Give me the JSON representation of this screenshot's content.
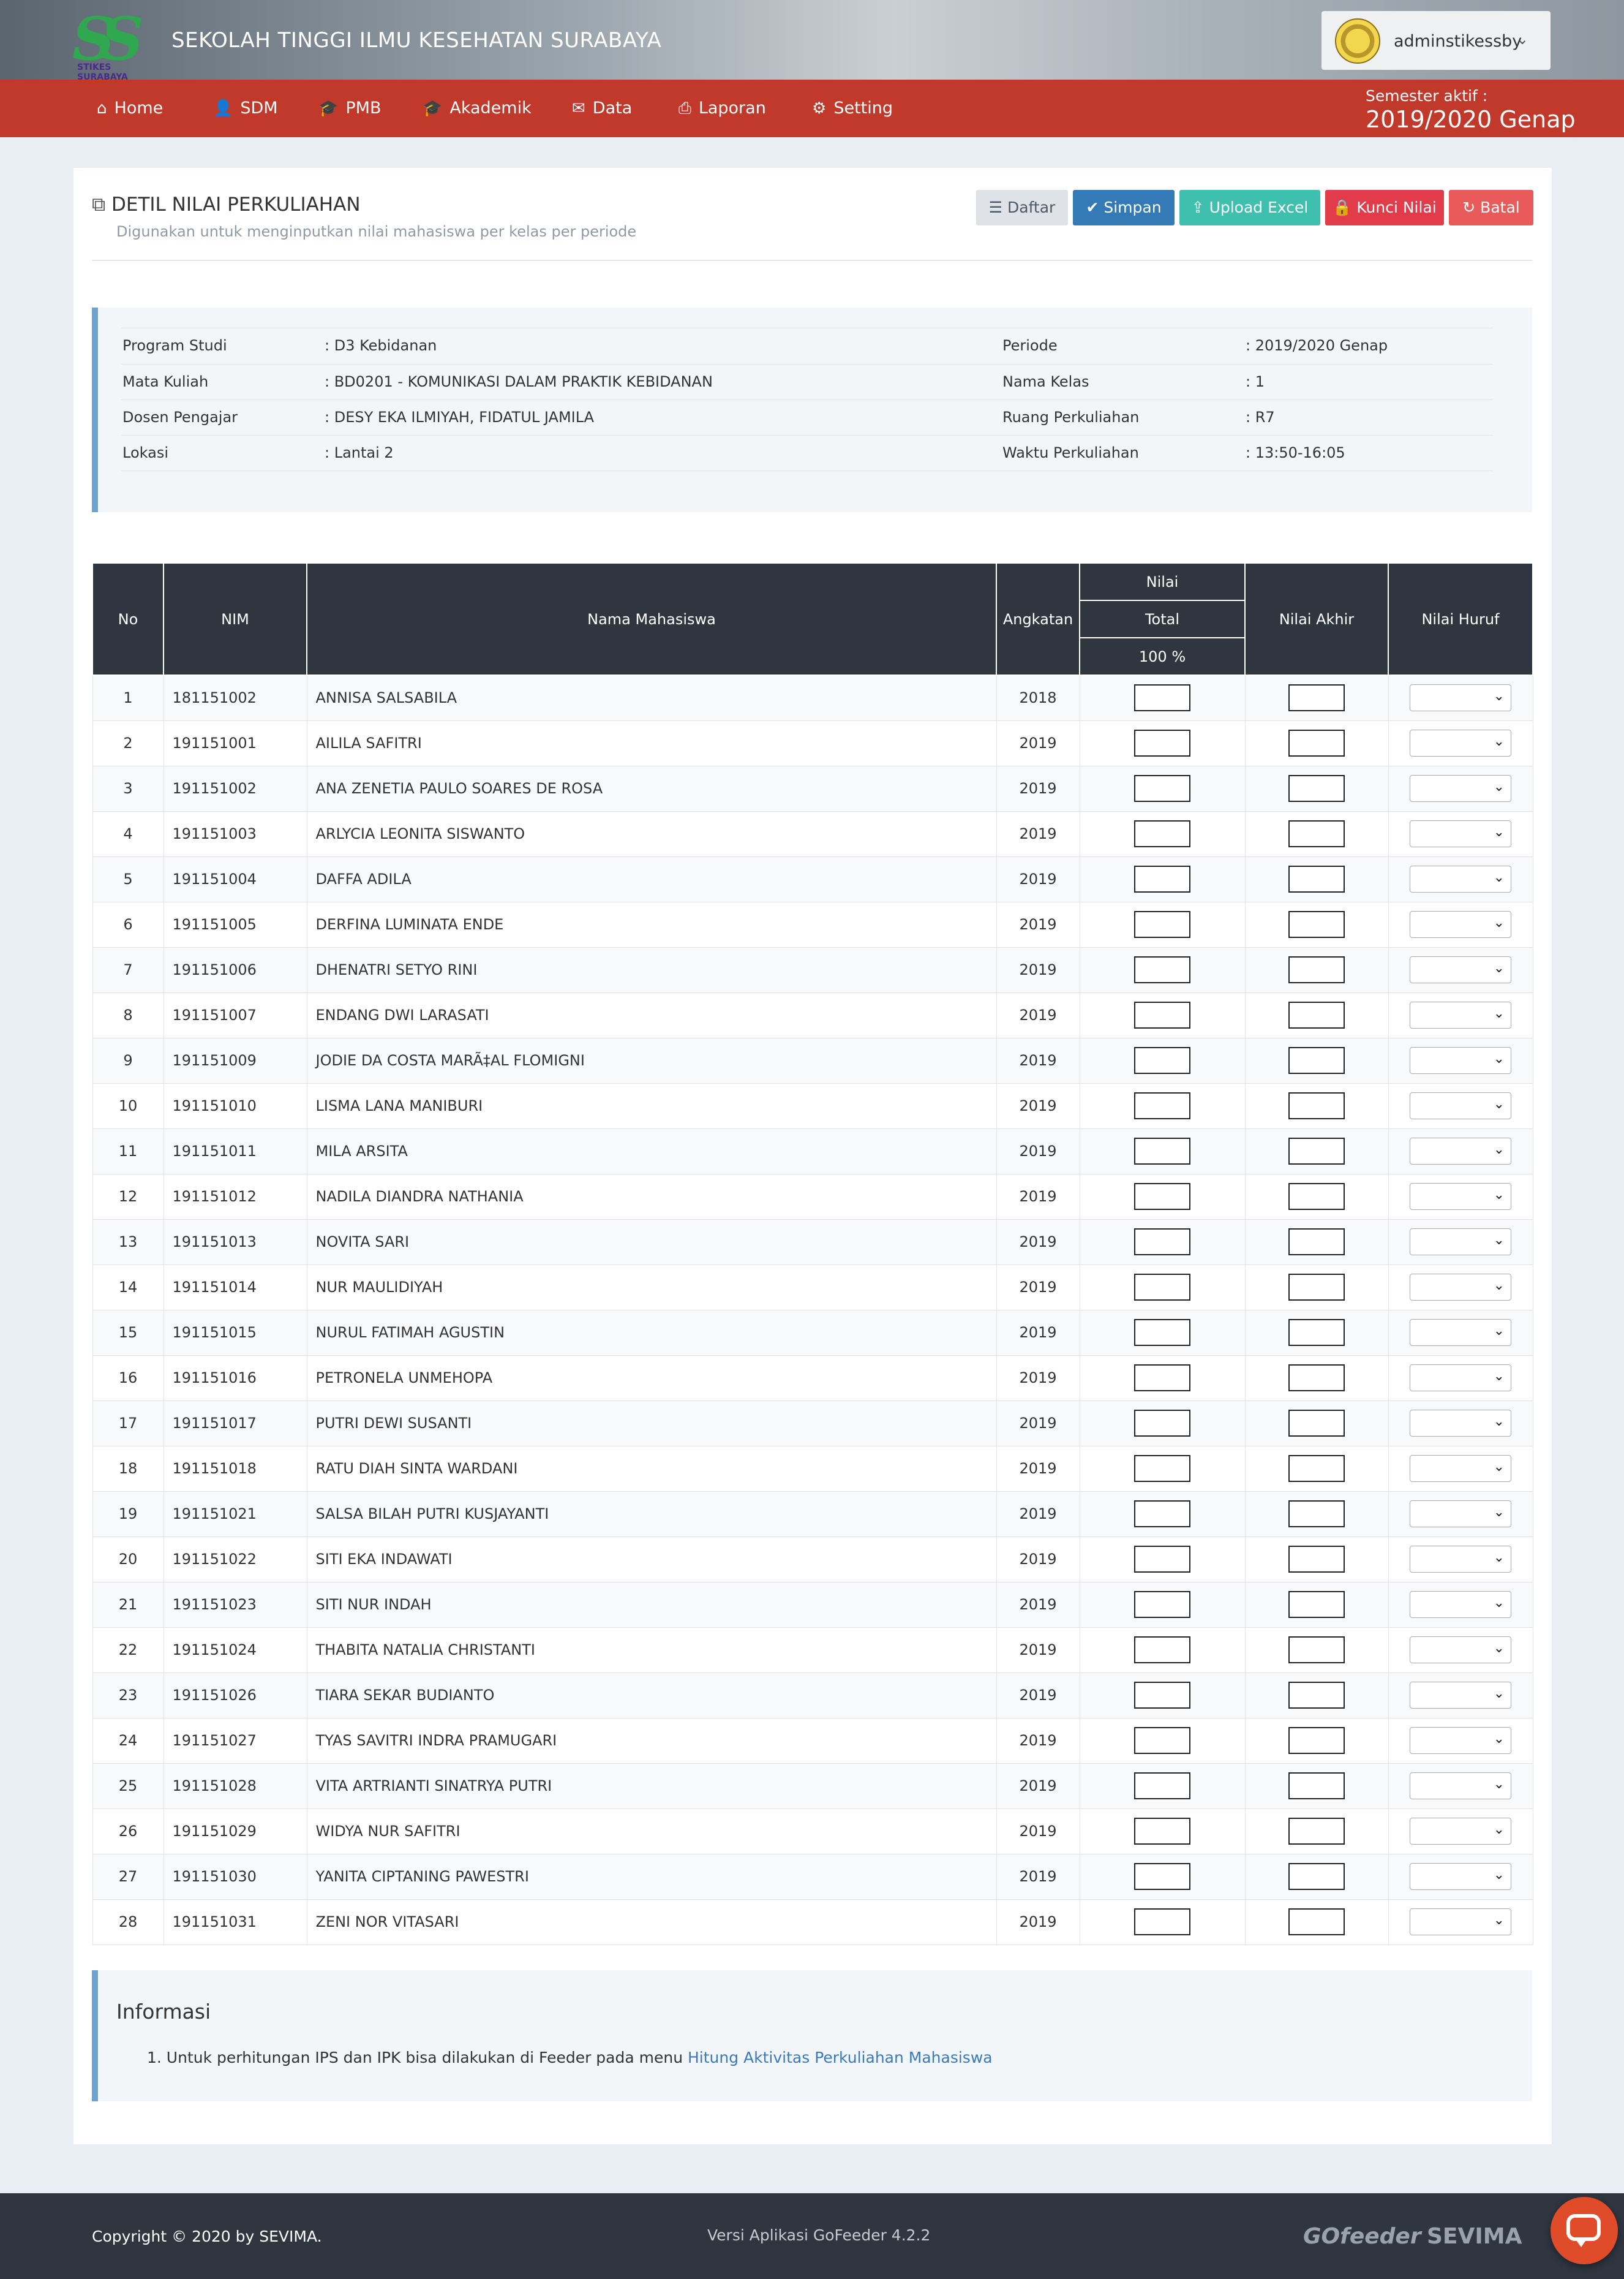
{
  "header": {
    "title": "SEKOLAH TINGGI ILMU KESEHATAN SURABAYA",
    "logo_text": "STIKES SURABAYA",
    "username": "adminstikessby"
  },
  "nav": [
    {
      "label": "Home",
      "icon": "home-icon"
    },
    {
      "label": "SDM",
      "icon": "user-icon"
    },
    {
      "label": "PMB",
      "icon": "graduation-cap-icon"
    },
    {
      "label": "Akademik",
      "icon": "graduation-cap-icon"
    },
    {
      "label": "Data",
      "icon": "inbox-icon"
    },
    {
      "label": "Laporan",
      "icon": "printer-icon"
    },
    {
      "label": "Setting",
      "icon": "gear-icon"
    }
  ],
  "semester": {
    "label": "Semester aktif :",
    "value": "2019/2020 Genap"
  },
  "page": {
    "title": "DETIL NILAI PERKULIAHAN",
    "subtitle": "Digunakan untuk menginputkan nilai mahasiswa per kelas per periode"
  },
  "buttons": {
    "daftar": "Daftar",
    "simpan": "Simpan",
    "upload": "Upload Excel",
    "kunci": "Kunci Nilai",
    "batal": "Batal"
  },
  "colors": {
    "red": "#c0392b",
    "blue": "#337ab7",
    "teal": "#3fbfad",
    "danger": "#e23b4a",
    "dark": "#2f3640"
  },
  "info": {
    "left": [
      {
        "label": "Program Studi",
        "value": ": D3 Kebidanan"
      },
      {
        "label": "Mata Kuliah",
        "value": ": BD0201 - KOMUNIKASI DALAM PRAKTIK KEBIDANAN"
      },
      {
        "label": "Dosen Pengajar",
        "value": ": DESY EKA ILMIYAH, FIDATUL JAMILA"
      },
      {
        "label": "Lokasi",
        "value": ": Lantai 2"
      }
    ],
    "right": [
      {
        "label": "Periode",
        "value": ": 2019/2020 Genap"
      },
      {
        "label": "Nama Kelas",
        "value": ": 1"
      },
      {
        "label": "Ruang Perkuliahan",
        "value": ": R7"
      },
      {
        "label": "Waktu Perkuliahan",
        "value": ": 13:50-16:05"
      }
    ]
  },
  "table": {
    "headers": {
      "no": "No",
      "nim": "NIM",
      "nama": "Nama Mahasiswa",
      "angkatan": "Angkatan",
      "nilai": "Nilai",
      "total": "Total",
      "pct": "100 %",
      "akhir": "Nilai Akhir",
      "huruf": "Nilai Huruf"
    },
    "rows": [
      {
        "no": "1",
        "nim": "181151002",
        "nama": "ANNISA SALSABILA",
        "angkatan": "2018"
      },
      {
        "no": "2",
        "nim": "191151001",
        "nama": "AILILA SAFITRI",
        "angkatan": "2019"
      },
      {
        "no": "3",
        "nim": "191151002",
        "nama": "ANA ZENETIA PAULO SOARES DE ROSA",
        "angkatan": "2019"
      },
      {
        "no": "4",
        "nim": "191151003",
        "nama": "ARLYCIA LEONITA SISWANTO",
        "angkatan": "2019"
      },
      {
        "no": "5",
        "nim": "191151004",
        "nama": "DAFFA ADILA",
        "angkatan": "2019"
      },
      {
        "no": "6",
        "nim": "191151005",
        "nama": "DERFINA LUMINATA ENDE",
        "angkatan": "2019"
      },
      {
        "no": "7",
        "nim": "191151006",
        "nama": "DHENATRI SETYO RINI",
        "angkatan": "2019"
      },
      {
        "no": "8",
        "nim": "191151007",
        "nama": "ENDANG DWI LARASATI",
        "angkatan": "2019"
      },
      {
        "no": "9",
        "nim": "191151009",
        "nama": "JODIE DA COSTA MARÃ‡AL FLOMIGNI",
        "angkatan": "2019"
      },
      {
        "no": "10",
        "nim": "191151010",
        "nama": "LISMA LANA MANIBURI",
        "angkatan": "2019"
      },
      {
        "no": "11",
        "nim": "191151011",
        "nama": "MILA ARSITA",
        "angkatan": "2019"
      },
      {
        "no": "12",
        "nim": "191151012",
        "nama": "NADILA DIANDRA NATHANIA",
        "angkatan": "2019"
      },
      {
        "no": "13",
        "nim": "191151013",
        "nama": "NOVITA SARI",
        "angkatan": "2019"
      },
      {
        "no": "14",
        "nim": "191151014",
        "nama": "NUR MAULIDIYAH",
        "angkatan": "2019"
      },
      {
        "no": "15",
        "nim": "191151015",
        "nama": "NURUL FATIMAH AGUSTIN",
        "angkatan": "2019"
      },
      {
        "no": "16",
        "nim": "191151016",
        "nama": "PETRONELA UNMEHOPA",
        "angkatan": "2019"
      },
      {
        "no": "17",
        "nim": "191151017",
        "nama": "PUTRI DEWI SUSANTI",
        "angkatan": "2019"
      },
      {
        "no": "18",
        "nim": "191151018",
        "nama": "RATU DIAH SINTA WARDANI",
        "angkatan": "2019"
      },
      {
        "no": "19",
        "nim": "191151021",
        "nama": "SALSA BILAH PUTRI KUSJAYANTI",
        "angkatan": "2019"
      },
      {
        "no": "20",
        "nim": "191151022",
        "nama": "SITI EKA INDAWATI",
        "angkatan": "2019"
      },
      {
        "no": "21",
        "nim": "191151023",
        "nama": "SITI NUR INDAH",
        "angkatan": "2019"
      },
      {
        "no": "22",
        "nim": "191151024",
        "nama": "THABITA NATALIA CHRISTANTI",
        "angkatan": "2019"
      },
      {
        "no": "23",
        "nim": "191151026",
        "nama": "TIARA SEKAR BUDIANTO",
        "angkatan": "2019"
      },
      {
        "no": "24",
        "nim": "191151027",
        "nama": "TYAS SAVITRI INDRA PRAMUGARI",
        "angkatan": "2019"
      },
      {
        "no": "25",
        "nim": "191151028",
        "nama": "VITA ARTRIANTI SINATRYA PUTRI",
        "angkatan": "2019"
      },
      {
        "no": "26",
        "nim": "191151029",
        "nama": "WIDYA NUR SAFITRI",
        "angkatan": "2019"
      },
      {
        "no": "27",
        "nim": "191151030",
        "nama": "YANITA CIPTANING PAWESTRI",
        "angkatan": "2019"
      },
      {
        "no": "28",
        "nim": "191151031",
        "nama": "ZENI NOR VITASARI",
        "angkatan": "2019"
      }
    ]
  },
  "informasi": {
    "title": "Informasi",
    "text": "1. Untuk perhitungan IPS dan IPK bisa dilakukan di Feeder pada menu ",
    "link": "Hitung Aktivitas Perkuliahan Mahasiswa"
  },
  "footer": {
    "copyright": "Copyright © 2020 by SEVIMA.",
    "version": "Versi Aplikasi GoFeeder 4.2.2",
    "gofeeder": "GOfeeder",
    "sevima": "SEVIMA"
  }
}
